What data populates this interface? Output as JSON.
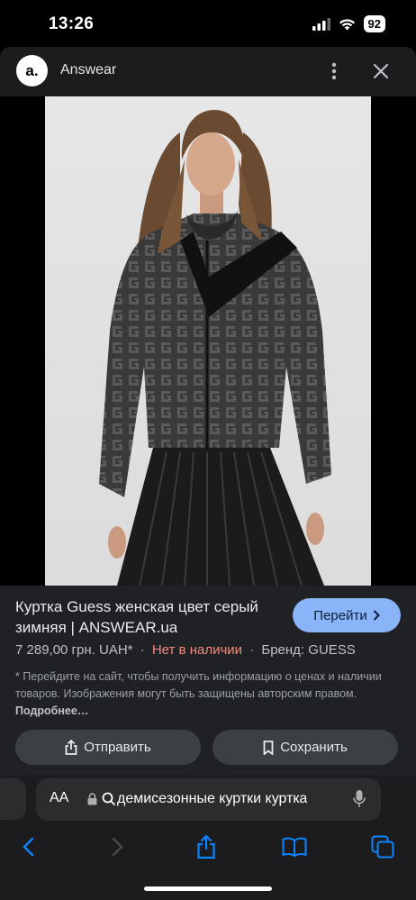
{
  "status_bar": {
    "time": "13:26",
    "battery": "92"
  },
  "header": {
    "logo_text": "a.",
    "site_name": "Answear"
  },
  "result": {
    "title": "Куртка Guess женская цвет серый зимняя | ANSWEAR.ua",
    "visit_label": "Перейти",
    "price": "7 289,00 грн. UAH*",
    "stock": "Нет в наличии",
    "brand": "Бренд: GUESS",
    "disclaimer": "* Перейдите на сайт, чтобы получить информацию о ценах и наличии товаров. Изображения могут быть защищены авторским правом.",
    "more_link": "Подробнее…",
    "share_label": "Отправить",
    "save_label": "Сохранить"
  },
  "browser": {
    "aa_label": "AA",
    "address_text": "демисезонные куртки курткa"
  },
  "colors": {
    "accent": "#8ab4f8",
    "out_of_stock": "#f28b82",
    "safari_blue": "#0a84ff"
  }
}
